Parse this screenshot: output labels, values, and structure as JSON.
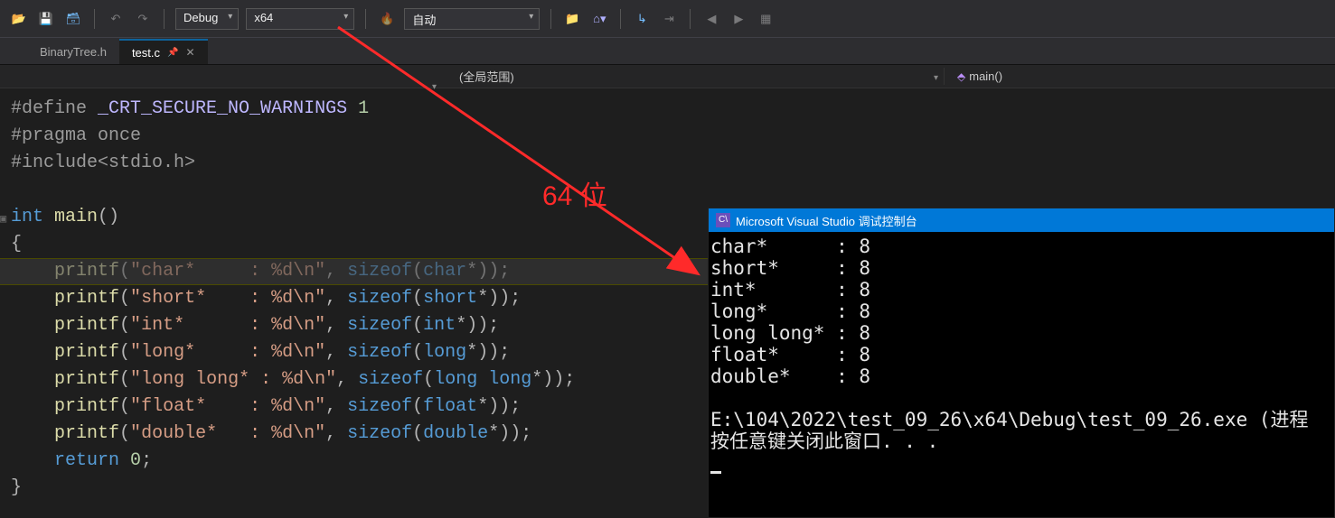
{
  "toolbar": {
    "config_label": "Debug",
    "platform_label": "x64",
    "start_mode_label": "自动"
  },
  "tabs": [
    {
      "label": "BinaryTree.h",
      "active": false
    },
    {
      "label": "test.c",
      "active": true
    }
  ],
  "scope": {
    "range_label": "(全局范围)",
    "symbol_label": "main()"
  },
  "code": {
    "line1_directive": "#define",
    "line1_macro": "_CRT_SECURE_NO_WARNINGS",
    "line1_val": "1",
    "line2_directive": "#pragma",
    "line2_arg": "once",
    "line3_directive": "#include",
    "line3_header": "<stdio.h>",
    "fn_type": "int",
    "fn_name": "main",
    "printf_lines": [
      {
        "label": "char*     : %d\\n",
        "type": "char"
      },
      {
        "label": "short*    : %d\\n",
        "type": "short"
      },
      {
        "label": "int*      : %d\\n",
        "type": "int"
      },
      {
        "label": "long*     : %d\\n",
        "type": "long"
      },
      {
        "label": "long long* : %d\\n",
        "type": "long long"
      },
      {
        "label": "float*    : %d\\n",
        "type": "float"
      },
      {
        "label": "double*   : %d\\n",
        "type": "double"
      }
    ],
    "return_kw": "return",
    "return_val": "0",
    "printf_fn": "printf",
    "sizeof_kw": "sizeof"
  },
  "console": {
    "title": "Microsoft Visual Studio 调试控制台",
    "rows": [
      "char*      : 8",
      "short*     : 8",
      "int*       : 8",
      "long*      : 8",
      "long long* : 8",
      "float*     : 8",
      "double*    : 8"
    ],
    "path_line": "E:\\104\\2022\\test_09_26\\x64\\Debug\\test_09_26.exe (进程",
    "prompt_line": "按任意键关闭此窗口. . ."
  },
  "annotation": {
    "label": "64 位"
  }
}
